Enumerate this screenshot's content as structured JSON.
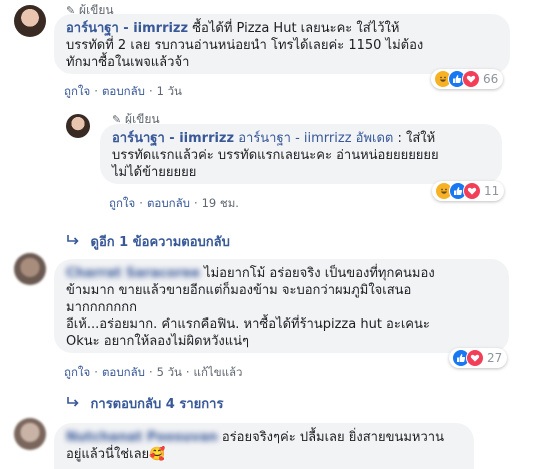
{
  "colors": {
    "link": "#385898",
    "bubble": "#f2f3f5",
    "meta": "#606770",
    "pin": "#4b4f56"
  },
  "comments": [
    {
      "author_badge": "ผู้เขียน",
      "name": "อาร์นาฐา - iimrrizz",
      "text_line1": " ซื้อได้ที่ Pizza Hut เลยนะคะ ใส่ไว้ให้",
      "text_line2": "บรรทัดที่ 2 เลย รบกวนอ่านหน่อยนำ โทรได้เลยค่ะ 1150 ไม่ต้อง",
      "text_line3": "ทักมาซื้อในเพจแล้วจ้า",
      "reaction_icons": [
        "haha-icon",
        "like-icon",
        "love-icon"
      ],
      "reaction_count": "66",
      "like": "ถูกใจ",
      "reply": "ตอบกลับ",
      "time": "1 วัน"
    },
    {
      "author_badge": "ผู้เขียน",
      "name": "อาร์นาฐา - iimrrizz",
      "updated_prefix": " อาร์นาฐา - iimrrizz ",
      "updated": "อัพเดต",
      "text_line1": " : ใส่ให้",
      "text_line2": "บรรทัดแรกแล้วค่ะ บรรทัดแรกเลยนะคะ อ่านหน่อยยยยยยย",
      "text_line3": "ไม่ได้ข้ายยยยย",
      "reaction_icons": [
        "haha-icon",
        "like-icon",
        "love-icon"
      ],
      "reaction_count": "11",
      "like": "ถูกใจ",
      "reply": "ตอบกลับ",
      "time": "19 ชม."
    },
    {
      "name": "Charrat Saracoree",
      "text_line1": " ไม่อยากโม้ อร่อยจริง เป็นของที่ทุกคนมอง",
      "text_line2": "ข้ามมาก ขายแล้วขายอีกแต่ก็มองข้าม จะบอกว่าผมภูมิใจเสนอ",
      "text_line3": "มากกกกกกก",
      "text_line4": "อีเห้...อร่อยมาก. คำแรกคือฟิน. หาซื้อได้ที่ร้านpizza hut อะเคนะ",
      "text_line5": "Okนะ อยากให้ลองไม่ผิดหวังแน่ๆ",
      "reaction_icons": [
        "like-icon",
        "love-icon"
      ],
      "reaction_count": "27",
      "like": "ถูกใจ",
      "reply": "ตอบกลับ",
      "time": "5 วัน",
      "edited": "แก้ไขแล้ว"
    },
    {
      "name": "Nutchanat Poosuvan",
      "text_line1": " อร่อยจริงๆค่ะ ปลื้มเลย ยิ่งสายขนมหวาน",
      "text_line2": "อยู่แล้วนี่ใช่เลย🥰"
    }
  ],
  "more_replies_1": "ดูอีก 1 ข้อความตอบกลับ",
  "more_replies_2": "การตอบกลับ 4 รายการ"
}
